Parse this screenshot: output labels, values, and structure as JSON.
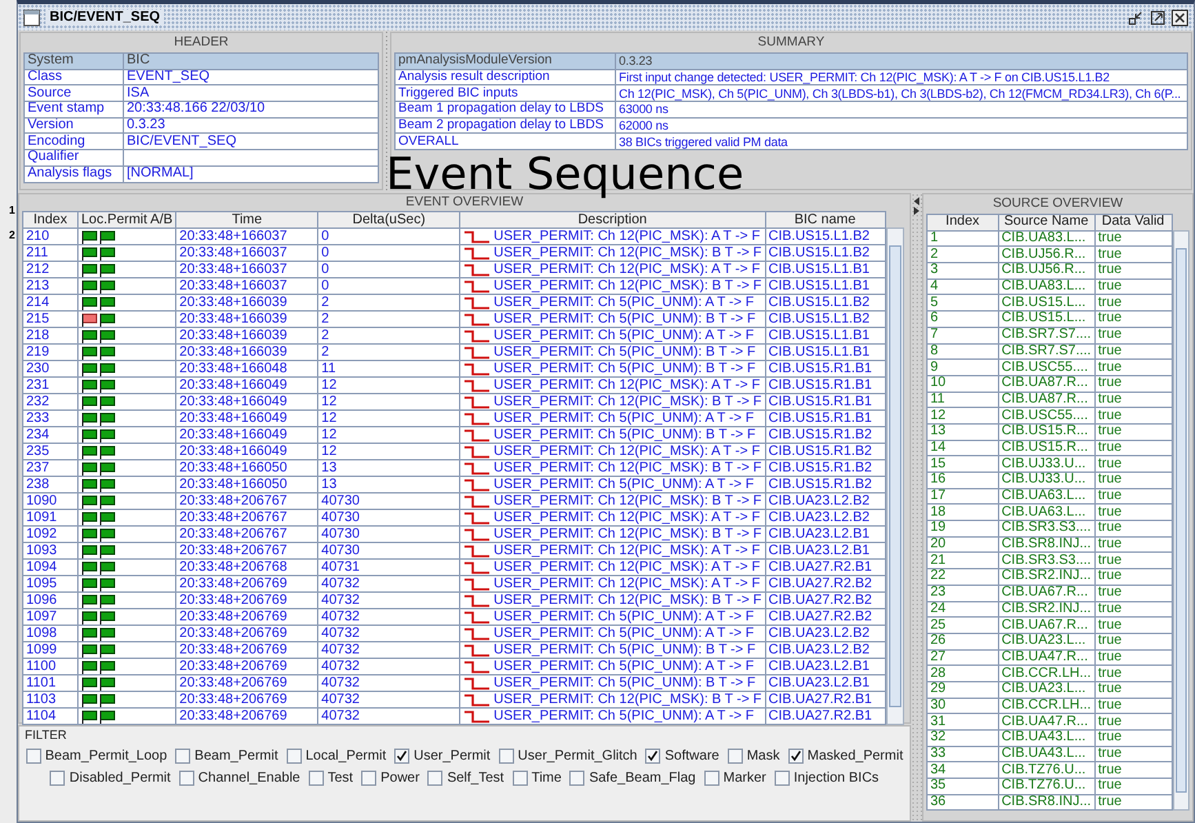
{
  "background_window": {
    "labels": [
      "1",
      "2"
    ]
  },
  "window": {
    "title": "BIC/EVENT_SEQ"
  },
  "overlay_caption": "Event Sequence",
  "header": {
    "title": "HEADER",
    "rows": [
      {
        "label": "System",
        "value": "BIC",
        "selected": true
      },
      {
        "label": "Class",
        "value": "EVENT_SEQ",
        "selected": false
      },
      {
        "label": "Source",
        "value": "ISA",
        "selected": false
      },
      {
        "label": "Event stamp",
        "value": "20:33:48.166 22/03/10",
        "selected": false
      },
      {
        "label": "Version",
        "value": "0.3.23",
        "selected": false
      },
      {
        "label": "Encoding",
        "value": "BIC/EVENT_SEQ",
        "selected": false
      },
      {
        "label": "Qualifier",
        "selected": false
      },
      {
        "label": "Analysis flags",
        "value": "[NORMAL]",
        "selected": false
      }
    ]
  },
  "summary": {
    "title": "SUMMARY",
    "rows": [
      {
        "label": "pmAnalysisModuleVersion",
        "value": "0.3.23",
        "selected": true
      },
      {
        "label": "Analysis result description",
        "value": "First input change detected: USER_PERMIT: Ch 12(PIC_MSK): A T -> F on CIB.US15.L1.B2",
        "selected": false
      },
      {
        "label": "Triggered BIC inputs",
        "value": "Ch 12(PIC_MSK),  Ch 5(PIC_UNM),  Ch 3(LBDS-b1),  Ch 3(LBDS-b2),  Ch 12(FMCM_RD34.LR3),  Ch 6(P...",
        "selected": false
      },
      {
        "label": "Beam 1 propagation delay to LBDS",
        "value": "63000 ns",
        "selected": false
      },
      {
        "label": "Beam 2 propagation delay to LBDS",
        "value": "62000 ns",
        "selected": false
      },
      {
        "label": "OVERALL",
        "value": "38 BICs triggered valid PM data",
        "selected": false
      }
    ]
  },
  "event_overview": {
    "title": "EVENT OVERVIEW",
    "columns": [
      "Index",
      "Loc.Permit A/B",
      "Time",
      "Delta(uSec)",
      "Description",
      "BIC name"
    ],
    "rows": [
      {
        "index": "210",
        "permit_a": true,
        "permit_b": true,
        "time": "20:33:48+166037",
        "delta": "0",
        "description": "USER_PERMIT: Ch 12(PIC_MSK): A T -> F",
        "bic_name": "CIB.US15.L1.B2"
      },
      {
        "index": "211",
        "permit_a": true,
        "permit_b": true,
        "time": "20:33:48+166037",
        "delta": "0",
        "description": "USER_PERMIT: Ch 12(PIC_MSK): B T -> F",
        "bic_name": "CIB.US15.L1.B2"
      },
      {
        "index": "212",
        "permit_a": true,
        "permit_b": true,
        "time": "20:33:48+166037",
        "delta": "0",
        "description": "USER_PERMIT: Ch 12(PIC_MSK): A T -> F",
        "bic_name": "CIB.US15.L1.B1"
      },
      {
        "index": "213",
        "permit_a": true,
        "permit_b": true,
        "time": "20:33:48+166037",
        "delta": "0",
        "description": "USER_PERMIT: Ch 12(PIC_MSK): B T -> F",
        "bic_name": "CIB.US15.L1.B1"
      },
      {
        "index": "214",
        "permit_a": true,
        "permit_b": true,
        "time": "20:33:48+166039",
        "delta": "2",
        "description": "USER_PERMIT: Ch 5(PIC_UNM): A T -> F",
        "bic_name": "CIB.US15.L1.B2"
      },
      {
        "index": "215",
        "permit_a": false,
        "permit_b": true,
        "time": "20:33:48+166039",
        "delta": "2",
        "description": "USER_PERMIT: Ch 5(PIC_UNM): B T -> F",
        "bic_name": "CIB.US15.L1.B2"
      },
      {
        "index": "218",
        "permit_a": true,
        "permit_b": true,
        "time": "20:33:48+166039",
        "delta": "2",
        "description": "USER_PERMIT: Ch 5(PIC_UNM): A T -> F",
        "bic_name": "CIB.US15.L1.B1"
      },
      {
        "index": "219",
        "permit_a": true,
        "permit_b": true,
        "time": "20:33:48+166039",
        "delta": "2",
        "description": "USER_PERMIT: Ch 5(PIC_UNM): B T -> F",
        "bic_name": "CIB.US15.L1.B1"
      },
      {
        "index": "230",
        "permit_a": true,
        "permit_b": true,
        "time": "20:33:48+166048",
        "delta": "11",
        "description": "USER_PERMIT: Ch 5(PIC_UNM): B T -> F",
        "bic_name": "CIB.US15.R1.B1"
      },
      {
        "index": "231",
        "permit_a": true,
        "permit_b": true,
        "time": "20:33:48+166049",
        "delta": "12",
        "description": "USER_PERMIT: Ch 12(PIC_MSK): A T -> F",
        "bic_name": "CIB.US15.R1.B1"
      },
      {
        "index": "232",
        "permit_a": true,
        "permit_b": true,
        "time": "20:33:48+166049",
        "delta": "12",
        "description": "USER_PERMIT: Ch 12(PIC_MSK): B T -> F",
        "bic_name": "CIB.US15.R1.B1"
      },
      {
        "index": "233",
        "permit_a": true,
        "permit_b": true,
        "time": "20:33:48+166049",
        "delta": "12",
        "description": "USER_PERMIT: Ch 5(PIC_UNM): A T -> F",
        "bic_name": "CIB.US15.R1.B1"
      },
      {
        "index": "234",
        "permit_a": true,
        "permit_b": true,
        "time": "20:33:48+166049",
        "delta": "12",
        "description": "USER_PERMIT: Ch 5(PIC_UNM): B T -> F",
        "bic_name": "CIB.US15.R1.B2"
      },
      {
        "index": "235",
        "permit_a": true,
        "permit_b": true,
        "time": "20:33:48+166049",
        "delta": "12",
        "description": "USER_PERMIT: Ch 12(PIC_MSK): A T -> F",
        "bic_name": "CIB.US15.R1.B2"
      },
      {
        "index": "237",
        "permit_a": true,
        "permit_b": true,
        "time": "20:33:48+166050",
        "delta": "13",
        "description": "USER_PERMIT: Ch 12(PIC_MSK): B T -> F",
        "bic_name": "CIB.US15.R1.B2"
      },
      {
        "index": "238",
        "permit_a": true,
        "permit_b": true,
        "time": "20:33:48+166050",
        "delta": "13",
        "description": "USER_PERMIT: Ch 5(PIC_UNM): A T -> F",
        "bic_name": "CIB.US15.R1.B2"
      },
      {
        "index": "1090",
        "permit_a": true,
        "permit_b": true,
        "time": "20:33:48+206767",
        "delta": "40730",
        "description": "USER_PERMIT: Ch 12(PIC_MSK): B T -> F",
        "bic_name": "CIB.UA23.L2.B2"
      },
      {
        "index": "1091",
        "permit_a": true,
        "permit_b": true,
        "time": "20:33:48+206767",
        "delta": "40730",
        "description": "USER_PERMIT: Ch 12(PIC_MSK): A T -> F",
        "bic_name": "CIB.UA23.L2.B2"
      },
      {
        "index": "1092",
        "permit_a": true,
        "permit_b": true,
        "time": "20:33:48+206767",
        "delta": "40730",
        "description": "USER_PERMIT: Ch 12(PIC_MSK): B T -> F",
        "bic_name": "CIB.UA23.L2.B1"
      },
      {
        "index": "1093",
        "permit_a": true,
        "permit_b": true,
        "time": "20:33:48+206767",
        "delta": "40730",
        "description": "USER_PERMIT: Ch 12(PIC_MSK): A T -> F",
        "bic_name": "CIB.UA23.L2.B1"
      },
      {
        "index": "1094",
        "permit_a": true,
        "permit_b": true,
        "time": "20:33:48+206768",
        "delta": "40731",
        "description": "USER_PERMIT: Ch 12(PIC_MSK): A T -> F",
        "bic_name": "CIB.UA27.R2.B1"
      },
      {
        "index": "1095",
        "permit_a": true,
        "permit_b": true,
        "time": "20:33:48+206769",
        "delta": "40732",
        "description": "USER_PERMIT: Ch 12(PIC_MSK): A T -> F",
        "bic_name": "CIB.UA27.R2.B2"
      },
      {
        "index": "1096",
        "permit_a": true,
        "permit_b": true,
        "time": "20:33:48+206769",
        "delta": "40732",
        "description": "USER_PERMIT: Ch 12(PIC_MSK): B T -> F",
        "bic_name": "CIB.UA27.R2.B2"
      },
      {
        "index": "1097",
        "permit_a": true,
        "permit_b": true,
        "time": "20:33:48+206769",
        "delta": "40732",
        "description": "USER_PERMIT: Ch 5(PIC_UNM): A T -> F",
        "bic_name": "CIB.UA27.R2.B2"
      },
      {
        "index": "1098",
        "permit_a": true,
        "permit_b": true,
        "time": "20:33:48+206769",
        "delta": "40732",
        "description": "USER_PERMIT: Ch 5(PIC_UNM): A T -> F",
        "bic_name": "CIB.UA23.L2.B2"
      },
      {
        "index": "1099",
        "permit_a": true,
        "permit_b": true,
        "time": "20:33:48+206769",
        "delta": "40732",
        "description": "USER_PERMIT: Ch 5(PIC_UNM): B T -> F",
        "bic_name": "CIB.UA23.L2.B2"
      },
      {
        "index": "1100",
        "permit_a": true,
        "permit_b": true,
        "time": "20:33:48+206769",
        "delta": "40732",
        "description": "USER_PERMIT: Ch 5(PIC_UNM): A T -> F",
        "bic_name": "CIB.UA23.L2.B1"
      },
      {
        "index": "1101",
        "permit_a": true,
        "permit_b": true,
        "time": "20:33:48+206769",
        "delta": "40732",
        "description": "USER_PERMIT: Ch 5(PIC_UNM): B T -> F",
        "bic_name": "CIB.UA23.L2.B1"
      },
      {
        "index": "1103",
        "permit_a": true,
        "permit_b": true,
        "time": "20:33:48+206769",
        "delta": "40732",
        "description": "USER_PERMIT: Ch 12(PIC_MSK): B T -> F",
        "bic_name": "CIB.UA27.R2.B1"
      },
      {
        "index": "1104",
        "permit_a": true,
        "permit_b": true,
        "time": "20:33:48+206769",
        "delta": "40732",
        "description": "USER_PERMIT: Ch 5(PIC_UNM): A T -> F",
        "bic_name": "CIB.UA27.R2.B1"
      }
    ]
  },
  "filter": {
    "title": "FILTER",
    "lines": [
      {
        "options": [
          {
            "label": "Beam_Permit_Loop",
            "checked": false
          },
          {
            "label": "Beam_Permit",
            "checked": false
          },
          {
            "label": "Local_Permit",
            "checked": false
          },
          {
            "label": "User_Permit",
            "checked": true
          },
          {
            "label": "User_Permit_Glitch",
            "checked": false
          },
          {
            "label": "Software",
            "checked": true
          },
          {
            "label": "Mask",
            "checked": false
          },
          {
            "label": "Masked_Permit",
            "checked": true
          }
        ]
      },
      {
        "options": [
          {
            "label": "Disabled_Permit",
            "checked": false
          },
          {
            "label": "Channel_Enable",
            "checked": false
          },
          {
            "label": "Test",
            "checked": false
          },
          {
            "label": "Power",
            "checked": false
          },
          {
            "label": "Self_Test",
            "checked": false
          },
          {
            "label": "Time",
            "checked": false
          },
          {
            "label": "Safe_Beam_Flag",
            "checked": false
          },
          {
            "label": "Marker",
            "checked": false
          },
          {
            "label": "Injection BICs",
            "checked": false
          }
        ]
      }
    ]
  },
  "source_overview": {
    "title": "SOURCE OVERVIEW",
    "columns": [
      "Index",
      "Source Name",
      "Data Valid"
    ],
    "rows": [
      {
        "index": "1",
        "source_name": "CIB.UA83.L...",
        "data_valid": "true"
      },
      {
        "index": "2",
        "source_name": "CIB.UJ56.R...",
        "data_valid": "true"
      },
      {
        "index": "3",
        "source_name": "CIB.UJ56.R...",
        "data_valid": "true"
      },
      {
        "index": "4",
        "source_name": "CIB.UA83.L...",
        "data_valid": "true"
      },
      {
        "index": "5",
        "source_name": "CIB.US15.L...",
        "data_valid": "true"
      },
      {
        "index": "6",
        "source_name": "CIB.US15.L...",
        "data_valid": "true"
      },
      {
        "index": "7",
        "source_name": "CIB.SR7.S7....",
        "data_valid": "true"
      },
      {
        "index": "8",
        "source_name": "CIB.SR7.S7....",
        "data_valid": "true"
      },
      {
        "index": "9",
        "source_name": "CIB.USC55....",
        "data_valid": "true"
      },
      {
        "index": "10",
        "source_name": "CIB.UA87.R...",
        "data_valid": "true"
      },
      {
        "index": "11",
        "source_name": "CIB.UA87.R...",
        "data_valid": "true"
      },
      {
        "index": "12",
        "source_name": "CIB.USC55....",
        "data_valid": "true"
      },
      {
        "index": "13",
        "source_name": "CIB.US15.R...",
        "data_valid": "true"
      },
      {
        "index": "14",
        "source_name": "CIB.US15.R...",
        "data_valid": "true"
      },
      {
        "index": "15",
        "source_name": "CIB.UJ33.U...",
        "data_valid": "true"
      },
      {
        "index": "16",
        "source_name": "CIB.UJ33.U...",
        "data_valid": "true"
      },
      {
        "index": "17",
        "source_name": "CIB.UA63.L...",
        "data_valid": "true"
      },
      {
        "index": "18",
        "source_name": "CIB.UA63.L...",
        "data_valid": "true"
      },
      {
        "index": "19",
        "source_name": "CIB.SR3.S3....",
        "data_valid": "true"
      },
      {
        "index": "20",
        "source_name": "CIB.SR8.INJ...",
        "data_valid": "true"
      },
      {
        "index": "21",
        "source_name": "CIB.SR3.S3....",
        "data_valid": "true"
      },
      {
        "index": "22",
        "source_name": "CIB.SR2.INJ...",
        "data_valid": "true"
      },
      {
        "index": "23",
        "source_name": "CIB.UA67.R...",
        "data_valid": "true"
      },
      {
        "index": "24",
        "source_name": "CIB.SR2.INJ...",
        "data_valid": "true"
      },
      {
        "index": "25",
        "source_name": "CIB.UA67.R...",
        "data_valid": "true"
      },
      {
        "index": "26",
        "source_name": "CIB.UA23.L...",
        "data_valid": "true"
      },
      {
        "index": "27",
        "source_name": "CIB.UA47.R...",
        "data_valid": "true"
      },
      {
        "index": "28",
        "source_name": "CIB.CCR.LH...",
        "data_valid": "true"
      },
      {
        "index": "29",
        "source_name": "CIB.UA23.L...",
        "data_valid": "true"
      },
      {
        "index": "30",
        "source_name": "CIB.CCR.LH...",
        "data_valid": "true"
      },
      {
        "index": "31",
        "source_name": "CIB.UA47.R...",
        "data_valid": "true"
      },
      {
        "index": "32",
        "source_name": "CIB.UA43.L...",
        "data_valid": "true"
      },
      {
        "index": "33",
        "source_name": "CIB.UA43.L...",
        "data_valid": "true"
      },
      {
        "index": "34",
        "source_name": "CIB.TZ76.U...",
        "data_valid": "true"
      },
      {
        "index": "35",
        "source_name": "CIB.TZ76.U...",
        "data_valid": "true"
      },
      {
        "index": "36",
        "source_name": "CIB.SR8.INJ...",
        "data_valid": "true"
      }
    ]
  }
}
